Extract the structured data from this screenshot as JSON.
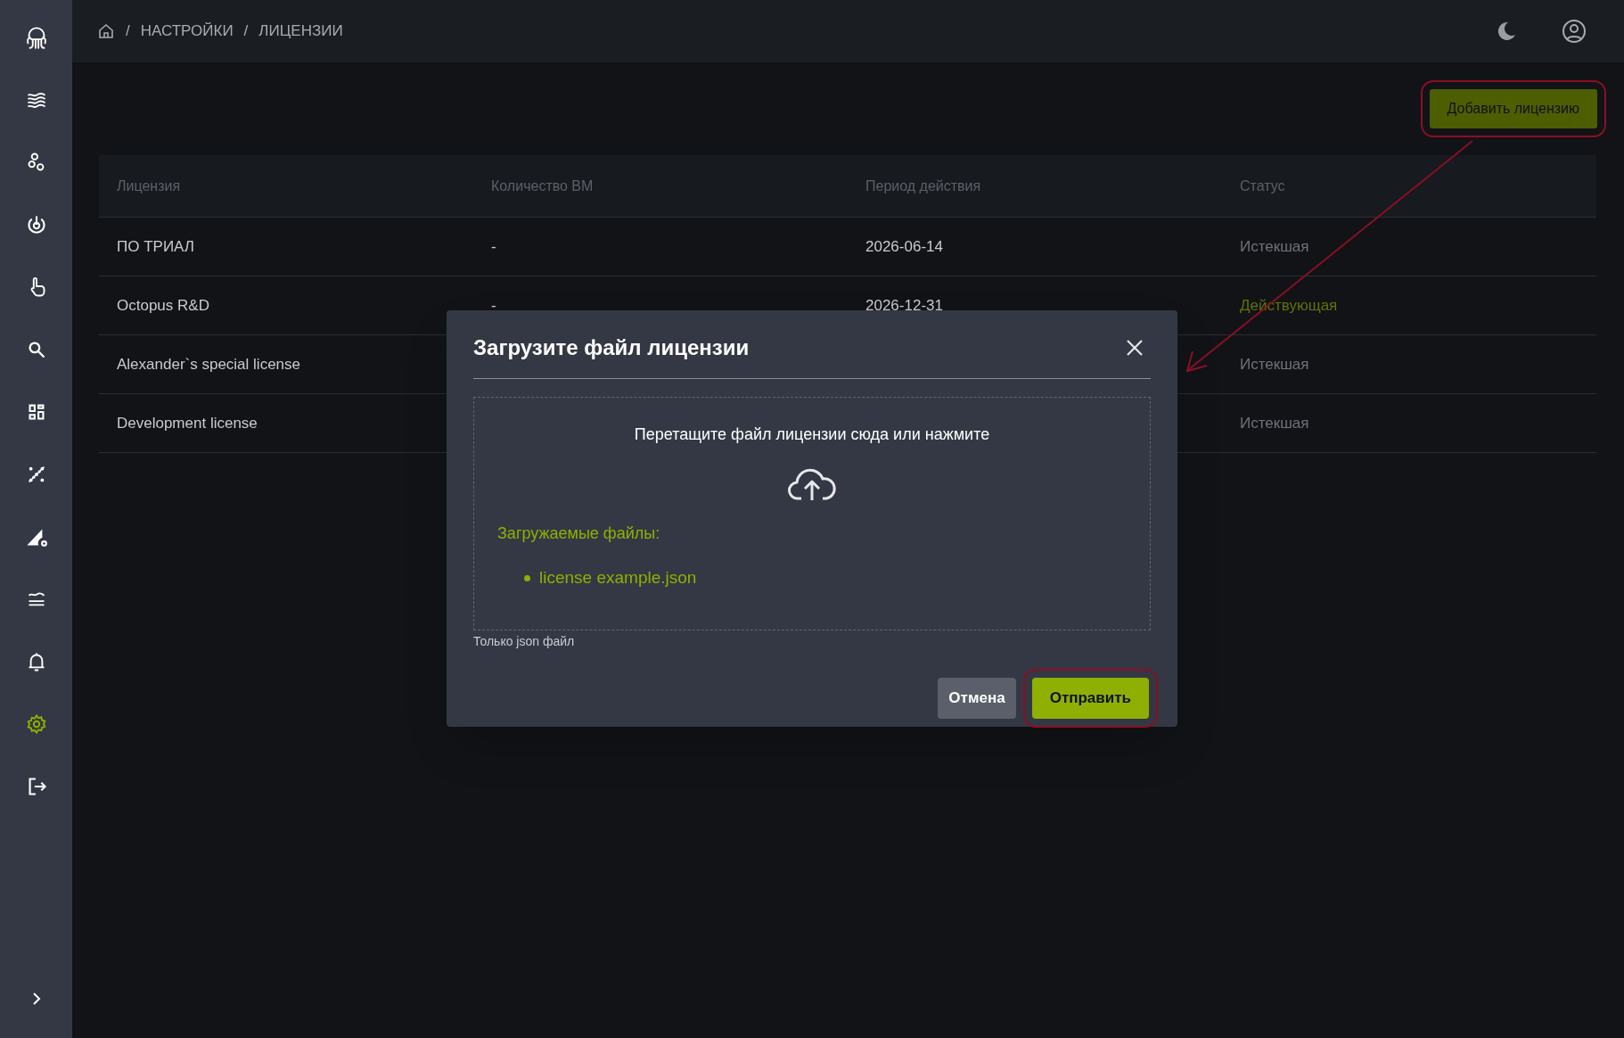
{
  "sidebar": {
    "items": [
      {
        "selected": false
      },
      {
        "selected": false
      },
      {
        "selected": false
      },
      {
        "selected": false
      },
      {
        "selected": false
      },
      {
        "selected": false
      },
      {
        "selected": false
      },
      {
        "selected": false
      },
      {
        "selected": false
      },
      {
        "selected": false
      },
      {
        "selected": false
      },
      {
        "selected": true
      },
      {
        "selected": false
      }
    ]
  },
  "breadcrumb": [
    {
      "separator": "/",
      "label": "НАСТРОЙКИ"
    },
    {
      "separator": "/",
      "label": "ЛИЦЕНЗИИ"
    }
  ],
  "add_button": {
    "label": "Добавить лицензию",
    "highlighted": true
  },
  "table": {
    "columns": [
      "Лицензия",
      "Количество ВМ",
      "Период действия",
      "Статус"
    ],
    "rows": [
      {
        "cells": [
          "ПО ТРИАЛ",
          "-",
          "2026-06-14",
          "Истекшая"
        ],
        "active": false
      },
      {
        "cells": [
          "Octopus R&D",
          "-",
          "2026-12-31",
          "Действующая"
        ],
        "active": true
      },
      {
        "cells": [
          "Alexander`s special license",
          "",
          "",
          "Истекшая"
        ],
        "active": false
      },
      {
        "cells": [
          "Development license",
          "",
          "",
          "Истекшая"
        ],
        "active": false
      }
    ]
  },
  "dialog": {
    "title": "Загрузите файл лицензии",
    "drop_text": "Перетащите файл лицензии сюда или нажмите",
    "files_label": "Загружаемые файлы:",
    "files": [
      "license example.json"
    ],
    "hint": "Только json файл",
    "buttons": [
      {
        "label": "Отмена",
        "kind": "secondary",
        "highlighted": false
      },
      {
        "label": "Отправить",
        "kind": "primary",
        "highlighted": true
      }
    ]
  },
  "callout_arrow": true
}
